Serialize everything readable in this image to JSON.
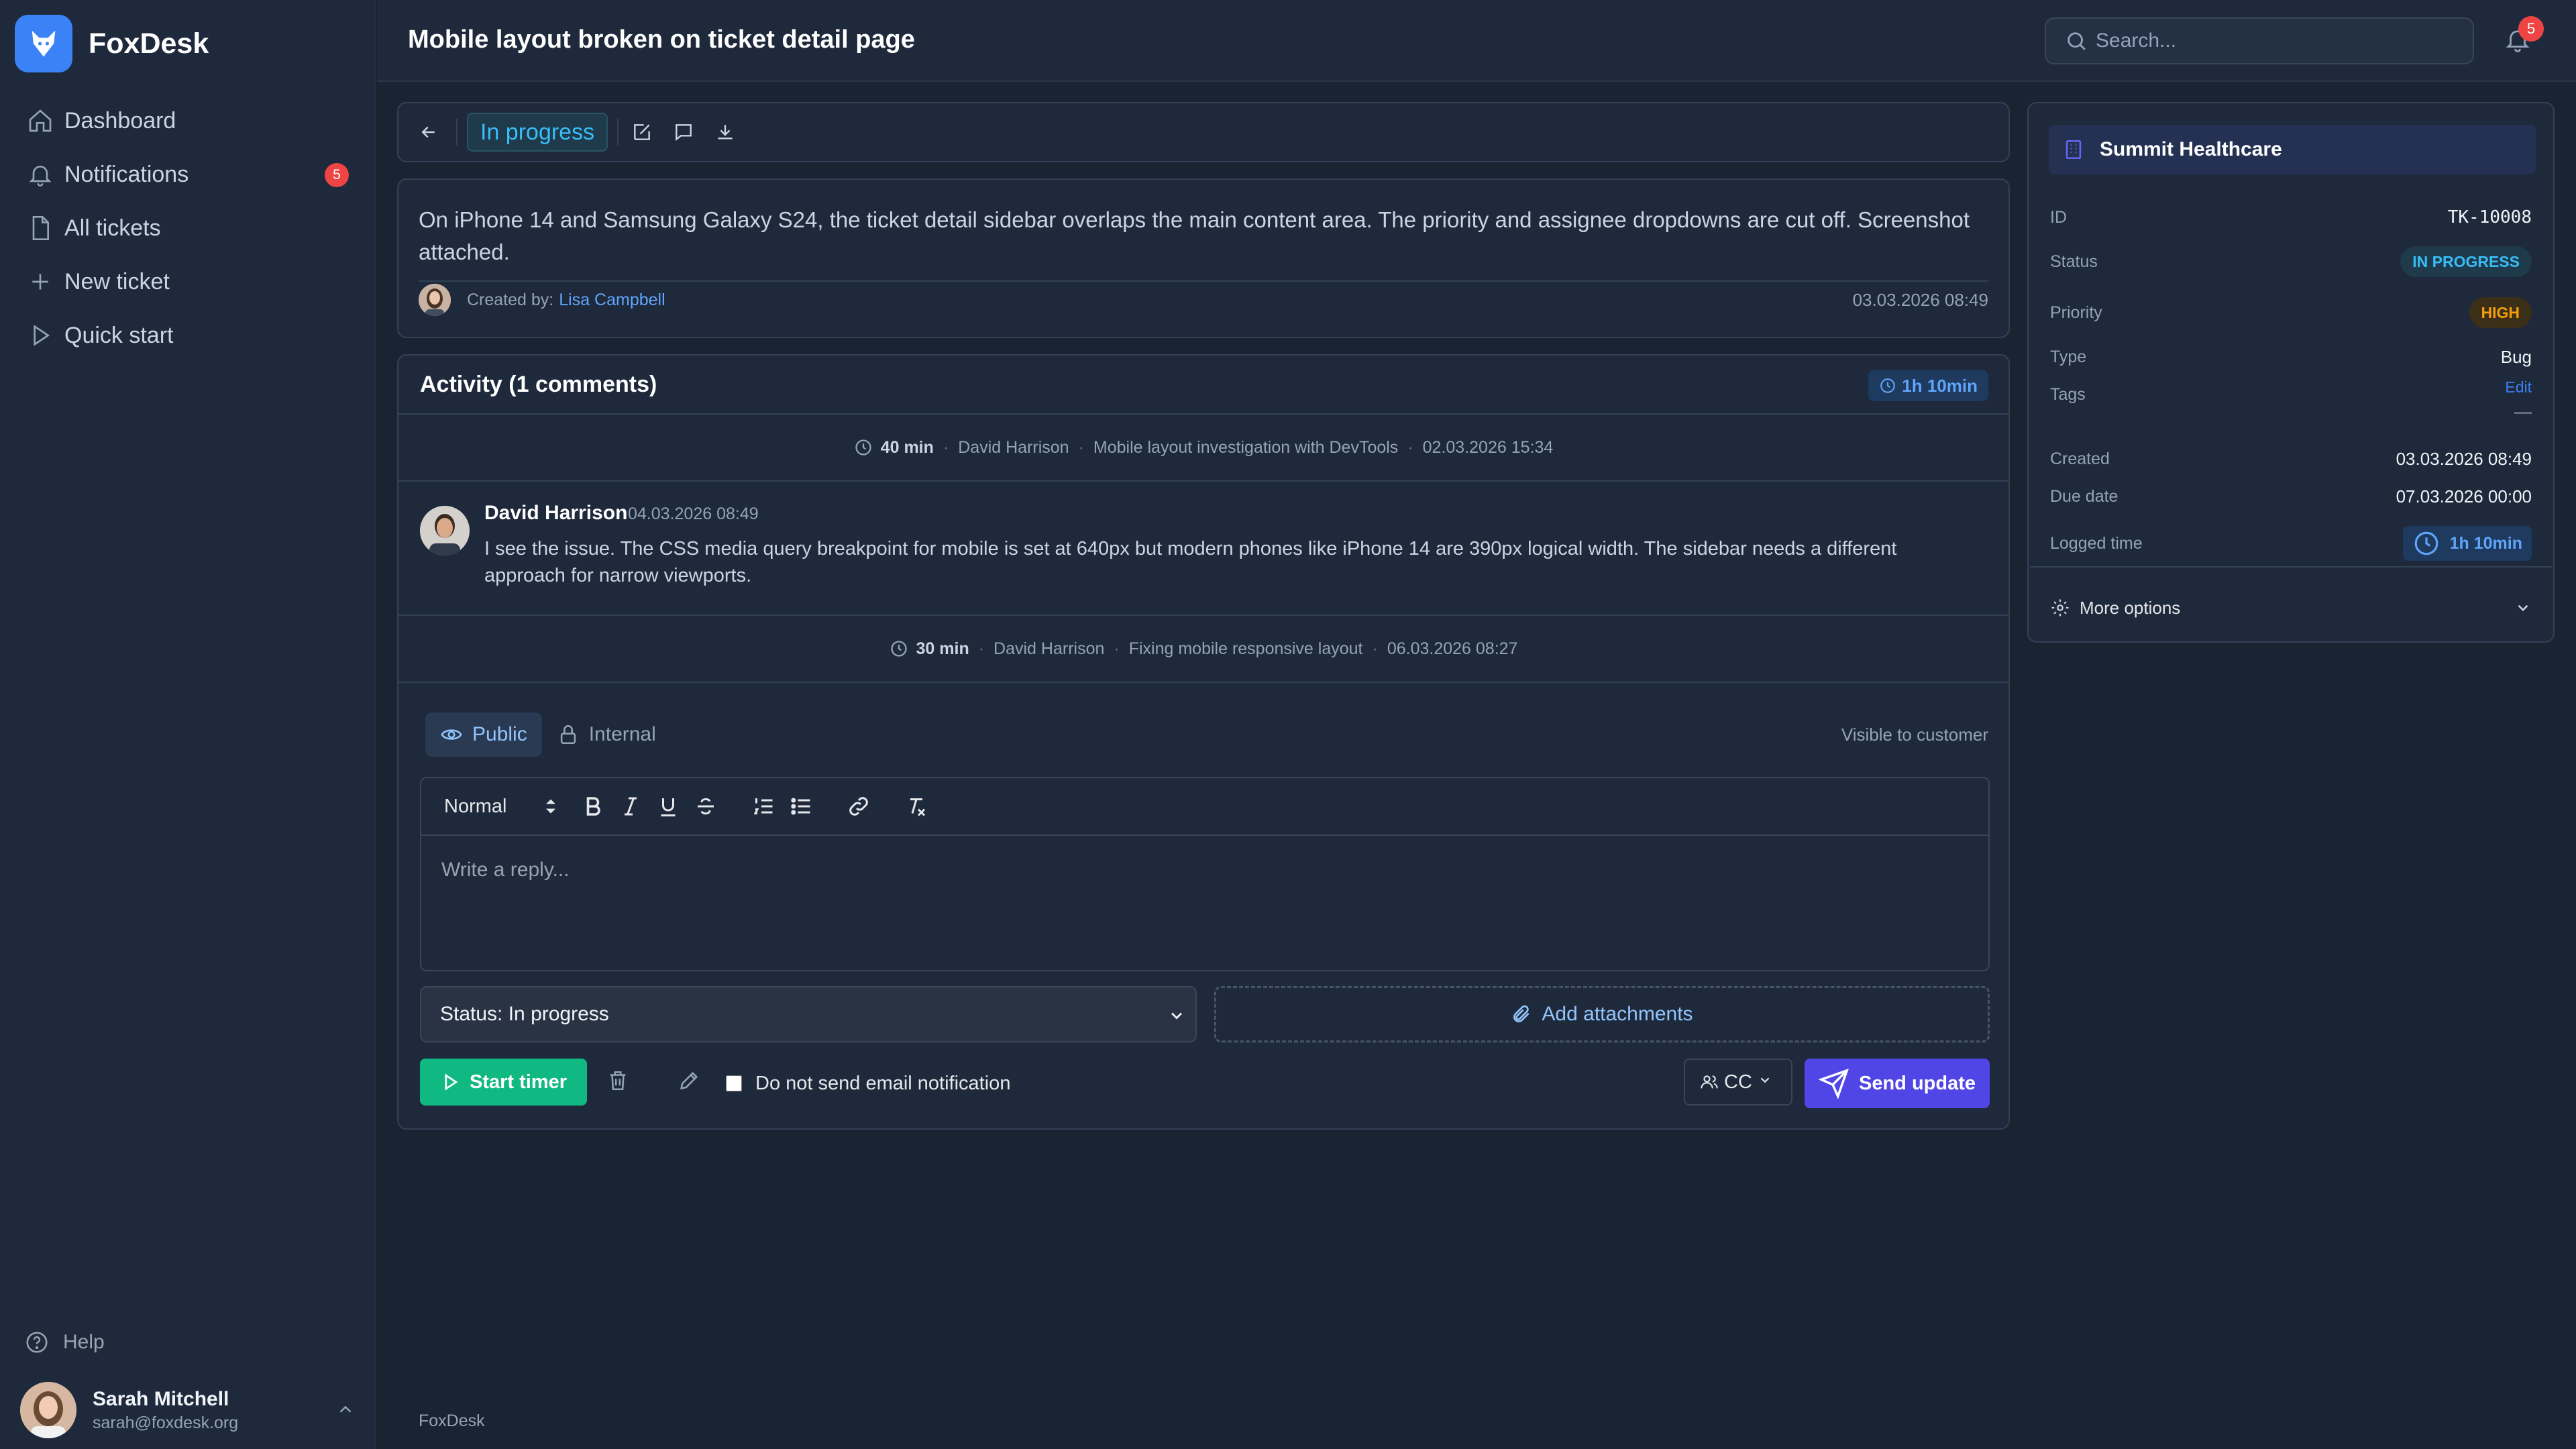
{
  "app": {
    "name": "FoxDesk"
  },
  "sidebar": {
    "items": [
      {
        "label": "Dashboard",
        "icon": "home-icon"
      },
      {
        "label": "Notifications",
        "icon": "bell-icon",
        "badge": "5"
      },
      {
        "label": "All tickets",
        "icon": "file-icon"
      },
      {
        "label": "New ticket",
        "icon": "plus-icon"
      },
      {
        "label": "Quick start",
        "icon": "play-icon"
      }
    ],
    "help": "Help",
    "user": {
      "name": "Sarah Mitchell",
      "email": "sarah@foxdesk.org"
    }
  },
  "header": {
    "title": "Mobile layout broken on ticket detail page",
    "search_placeholder": "Search...",
    "notification_count": "5"
  },
  "toolbar": {
    "status": "In progress"
  },
  "ticket": {
    "description": "On iPhone 14 and Samsung Galaxy S24, the ticket detail sidebar overlaps the main content area. The priority and assignee dropdowns are cut off. Screenshot attached.",
    "created_by_label": "Created by:",
    "created_by": "Lisa Campbell",
    "created_at": "03.03.2026 08:49"
  },
  "activity": {
    "title": "Activity (1 comments)",
    "total_time": "1h 10min",
    "logs": [
      {
        "duration": "40 min",
        "user": "David Harrison",
        "note": "Mobile layout investigation with DevTools",
        "date": "02.03.2026 15:34"
      },
      {
        "duration": "30 min",
        "user": "David Harrison",
        "note": "Fixing mobile responsive layout",
        "date": "06.03.2026 08:27"
      }
    ],
    "comment": {
      "author": "David Harrison",
      "date": "04.03.2026 08:49",
      "body": "I see the issue. The CSS media query breakpoint for mobile is set at 640px but modern phones like iPhone 14 are 390px logical width. The sidebar needs a different approach for narrow viewports."
    }
  },
  "reply": {
    "tab_public": "Public",
    "tab_internal": "Internal",
    "visible_note": "Visible to customer",
    "format": "Normal",
    "placeholder": "Write a reply...",
    "status_select": "Status: In progress",
    "attach": "Add attachments",
    "start_timer": "Start timer",
    "no_email": "Do not send email notification",
    "cc": "CC",
    "send": "Send update"
  },
  "details": {
    "org": "Summit Healthcare",
    "id_label": "ID",
    "id": "TK-10008",
    "status_label": "Status",
    "status": "IN PROGRESS",
    "priority_label": "Priority",
    "priority": "HIGH",
    "type_label": "Type",
    "type": "Bug",
    "tags_label": "Tags",
    "tags_edit": "Edit",
    "tags_value": "—",
    "created_label": "Created",
    "created": "03.03.2026 08:49",
    "due_label": "Due date",
    "due": "07.03.2026 00:00",
    "logged_label": "Logged time",
    "logged": "1h 10min",
    "more": "More options"
  },
  "footer": "FoxDesk",
  "colors": {
    "accent": "#4f46e5",
    "success": "#10b981",
    "status": "#38bdf8",
    "priority": "#f59e0b",
    "danger": "#ef4444"
  }
}
